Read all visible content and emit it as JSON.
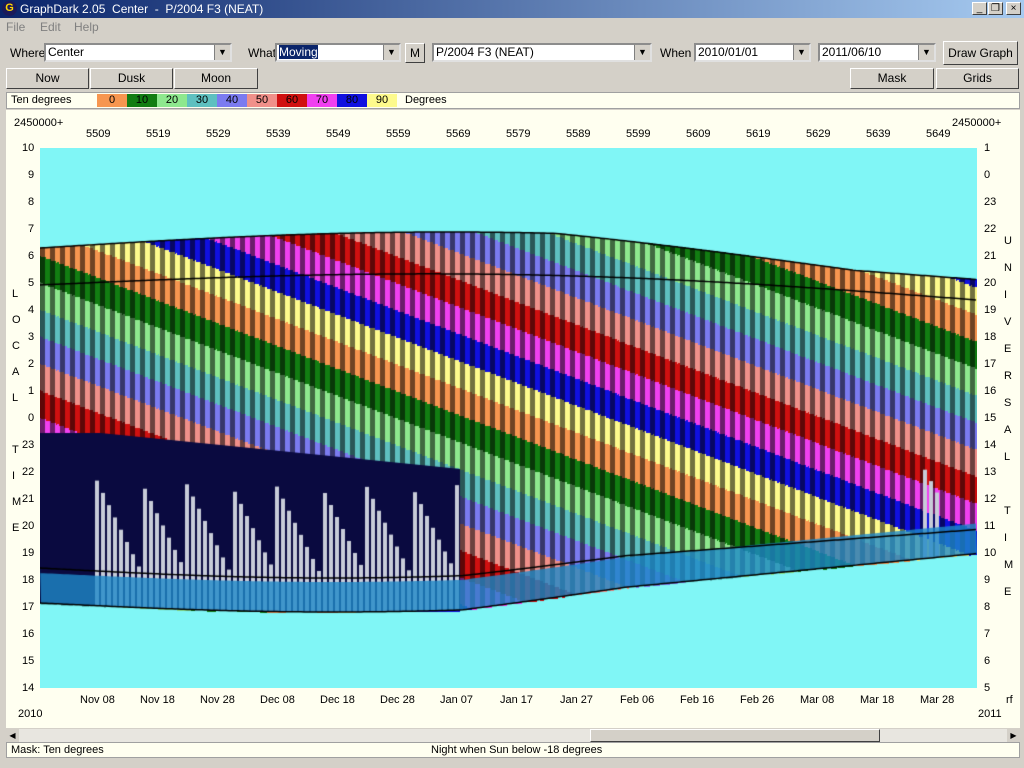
{
  "window": {
    "title": "GraphDark 2.05  Center  -  P/2004 F3 (NEAT)",
    "min_label": "_",
    "max_label": "❐",
    "close_label": "×"
  },
  "menu": [
    {
      "label": "File",
      "key": "F"
    },
    {
      "label": "Edit",
      "key": "E"
    },
    {
      "label": "Help",
      "key": "H"
    }
  ],
  "controls": {
    "where_label": "Where",
    "where_value": "Center",
    "what_label": "What",
    "what_value": "Moving",
    "m_button": "M",
    "object_value": "P/2004 F3 (NEAT)",
    "when_label": "When",
    "start_date": "2010/01/01",
    "end_date": "2011/06/10",
    "draw_button": "Draw Graph"
  },
  "buttons": {
    "now": "Now",
    "dusk": "Dusk",
    "moon": "Moon",
    "mask": "Mask",
    "grids": "Grids"
  },
  "legend": {
    "title": "Ten degrees",
    "unit": "Degrees",
    "items": [
      {
        "label": "0",
        "color": "#f79650"
      },
      {
        "label": "10",
        "color": "#127d12"
      },
      {
        "label": "20",
        "color": "#8ee88e"
      },
      {
        "label": "30",
        "color": "#5ec0c0"
      },
      {
        "label": "40",
        "color": "#7b7bf0"
      },
      {
        "label": "50",
        "color": "#f0908a"
      },
      {
        "label": "60",
        "color": "#d01010"
      },
      {
        "label": "70",
        "color": "#f040f0"
      },
      {
        "label": "80",
        "color": "#1010e0"
      },
      {
        "label": "90",
        "color": "#fdfa8c"
      }
    ]
  },
  "chart": {
    "top_left_label": "2450000+",
    "top_right_label": "2450000+",
    "jd_ticks": [
      "5509",
      "5519",
      "5529",
      "5539",
      "5549",
      "5559",
      "5569",
      "5579",
      "5589",
      "5599",
      "5609",
      "5619",
      "5629",
      "5639",
      "5649"
    ],
    "date_ticks": [
      "Nov 08",
      "Nov 18",
      "Nov 28",
      "Dec 08",
      "Dec 18",
      "Dec 28",
      "Jan 07",
      "Jan 17",
      "Jan 27",
      "Feb 06",
      "Feb 16",
      "Feb 26",
      "Mar 08",
      "Mar 18",
      "Mar 28"
    ],
    "year_left": "2010",
    "year_right": "2011",
    "bottom_right_label": "rf",
    "left_ticks": [
      "10",
      "9",
      "8",
      "7",
      "6",
      "5",
      "4",
      "3",
      "2",
      "1",
      "0",
      "23",
      "22",
      "21",
      "20",
      "19",
      "18",
      "17",
      "16",
      "15",
      "14"
    ],
    "right_ticks": [
      "1",
      "0",
      "23",
      "22",
      "21",
      "20",
      "19",
      "18",
      "17",
      "16",
      "15",
      "14",
      "13",
      "12",
      "11",
      "10",
      "9",
      "8",
      "7",
      "6",
      "5"
    ],
    "left_axis_letters": [
      "L",
      "O",
      "C",
      "A",
      "L",
      "",
      "T",
      "I",
      "M",
      "E"
    ],
    "right_axis_letters": [
      "U",
      "N",
      "I",
      "V",
      "E",
      "R",
      "S",
      "A",
      "L",
      "",
      "T",
      "I",
      "M",
      "E"
    ]
  },
  "status": {
    "left": "Mask:  Ten degrees",
    "center": "Night when Sun below -18 degrees"
  }
}
